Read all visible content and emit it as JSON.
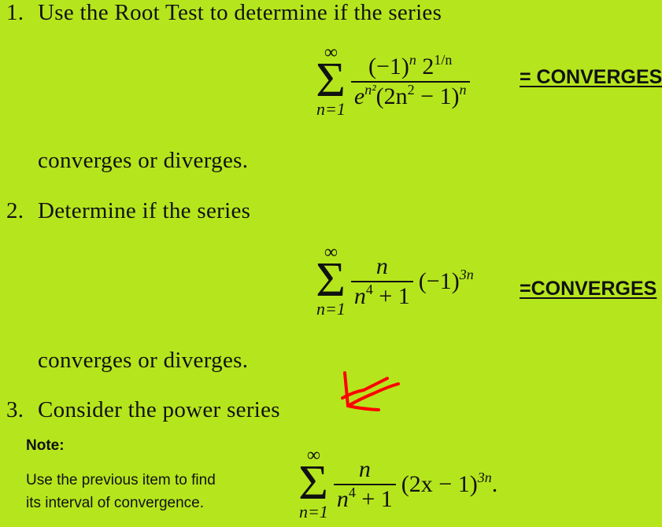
{
  "problems": [
    {
      "number": "1.",
      "prompt": "Use the Root Test to determine if the series",
      "series": {
        "upper": "∞",
        "lower": "n=1",
        "numerator_base1": "(−1)",
        "numerator_exp1": "n",
        "numerator_base2": " 2",
        "numerator_exp2": "1/n",
        "denominator_base1": "e",
        "denominator_exp1": "n²",
        "denominator_base2": "(2n",
        "denominator_exp2": "2",
        "denominator_rest": " − 1)",
        "denominator_exp3": "n"
      },
      "answer": "= CONVERGES",
      "suffix": "converges or diverges."
    },
    {
      "number": "2.",
      "prompt": "Determine if the series",
      "series": {
        "upper": "∞",
        "lower": "n=1",
        "numerator": "n",
        "denominator_base": "n",
        "denominator_exp": "4",
        "denominator_rest": " + 1",
        "tail_base": "(−1)",
        "tail_exp": "3n"
      },
      "answer": "=CONVERGES",
      "suffix": "converges or diverges."
    },
    {
      "number": "3.",
      "prompt": "Consider the power series",
      "series": {
        "upper": "∞",
        "lower": "n=1",
        "numerator": "n",
        "denominator_base": "n",
        "denominator_exp": "4",
        "denominator_rest": " + 1",
        "tail_base": "(2x − 1)",
        "tail_exp": "3n",
        "tail_end": "."
      }
    }
  ],
  "note": {
    "title": "Note:",
    "lines": [
      "Use the previous item to find",
      "its interval of convergence."
    ]
  },
  "annotation": {
    "icon": "red-arrow-icon",
    "color": "#ff0000"
  },
  "colors": {
    "background": "#b5e61d",
    "text": "#111111"
  }
}
